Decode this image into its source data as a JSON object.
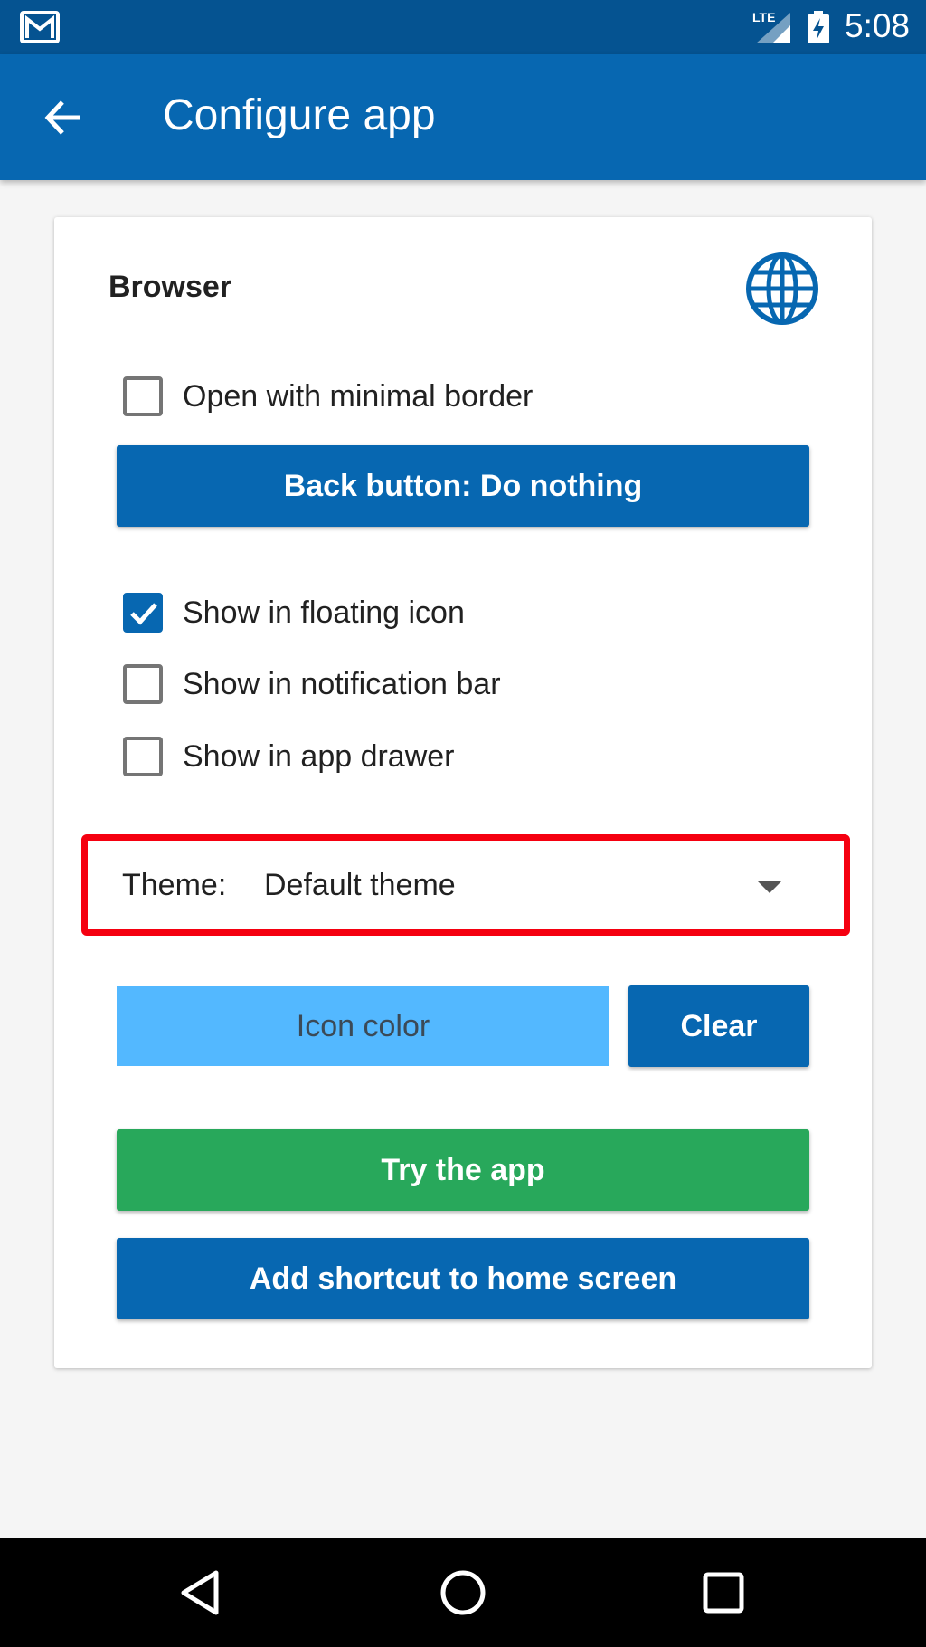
{
  "status_bar": {
    "time": "5:08",
    "network": "LTE",
    "notification_icon": "gmail-icon",
    "battery_icon": "battery-charging-icon"
  },
  "app_bar": {
    "title": "Configure app",
    "back_icon": "arrow-back-icon"
  },
  "card": {
    "title": "Browser",
    "icon": "globe-icon",
    "minimal_border": {
      "label": "Open with minimal border",
      "checked": false
    },
    "back_button_label": "Back button: Do nothing",
    "options": [
      {
        "label": "Show in floating icon",
        "checked": true
      },
      {
        "label": "Show in notification bar",
        "checked": false
      },
      {
        "label": "Show in app drawer",
        "checked": false
      }
    ],
    "theme": {
      "label": "Theme:",
      "value": "Default theme"
    },
    "icon_color_label": "Icon color",
    "clear_label": "Clear",
    "try_label": "Try the app",
    "shortcut_label": "Add shortcut to home screen"
  },
  "colors": {
    "primary": "#0767b1",
    "status_bar": "#055391",
    "success": "#28a85b",
    "icon_color_swatch": "#53b8ff",
    "highlight": "#f50010"
  },
  "nav_bar": {
    "back_icon": "nav-back-icon",
    "home_icon": "nav-home-icon",
    "recents_icon": "nav-recents-icon"
  }
}
